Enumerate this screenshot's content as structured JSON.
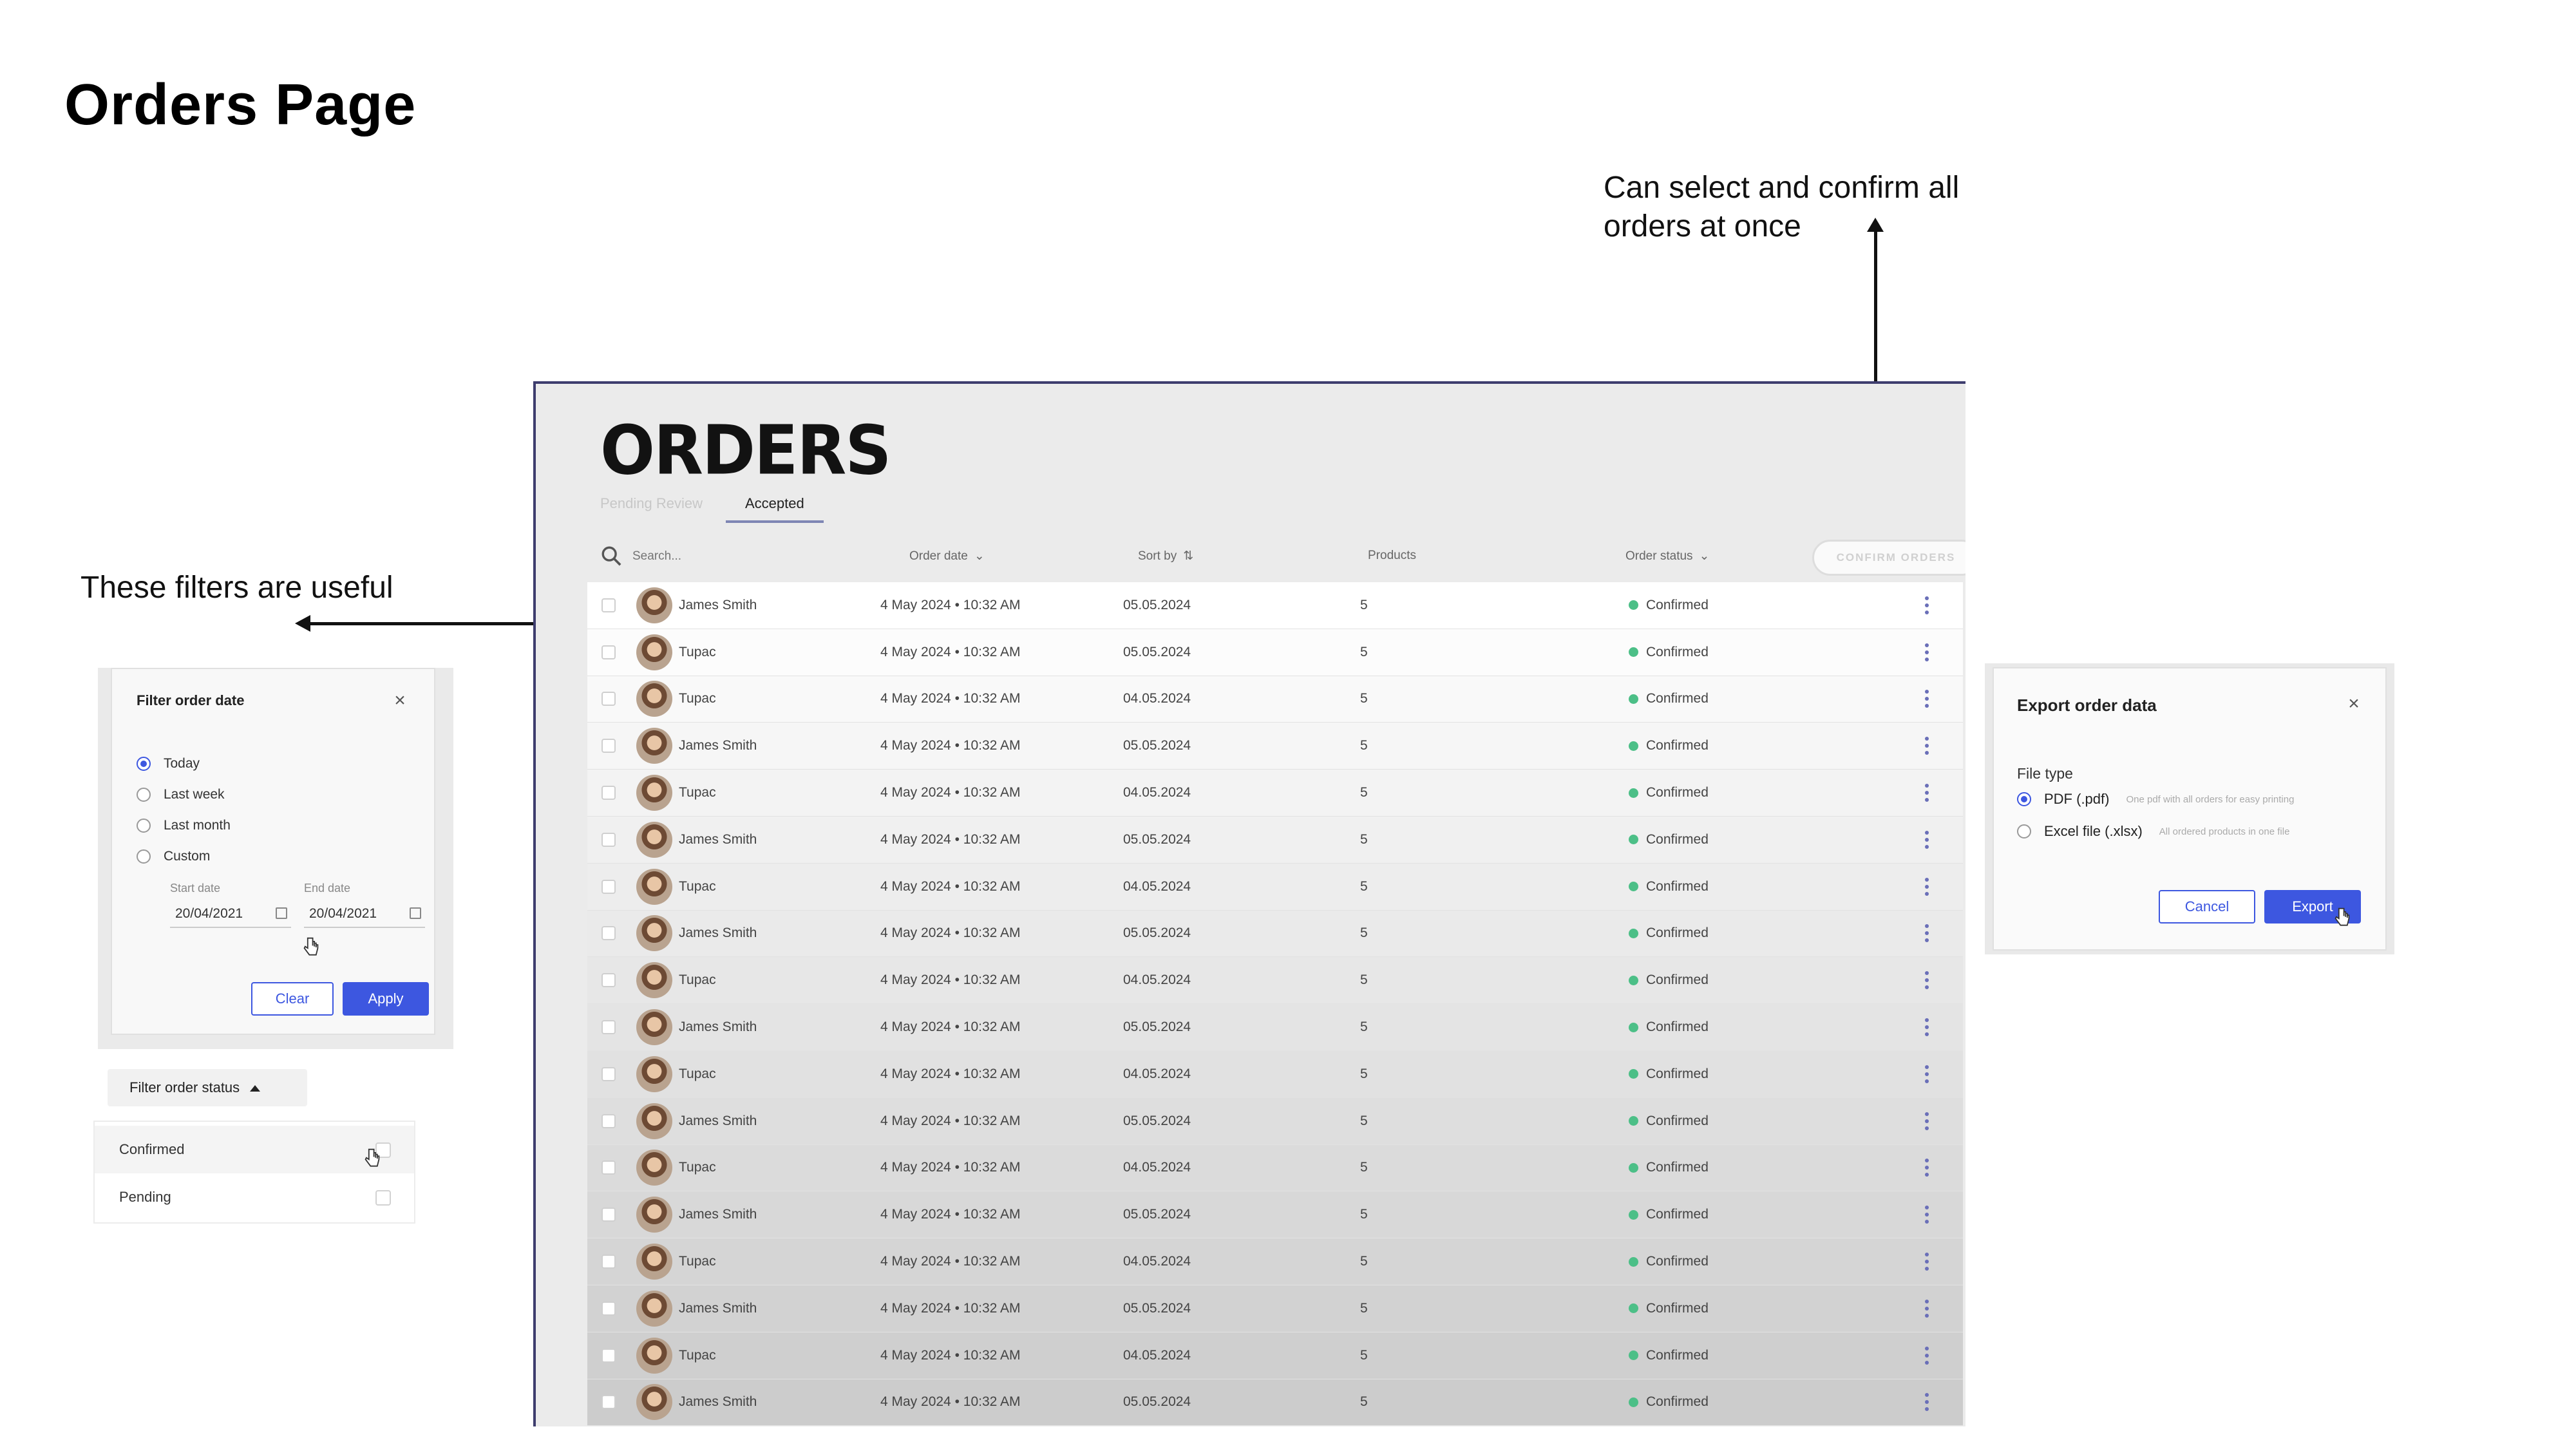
{
  "slide": {
    "title": "Orders Page",
    "note_confirm": "Can select and confirm all orders at once",
    "note_filters": "These filters are useful"
  },
  "orders": {
    "heading": "ORDERS",
    "tabs": [
      {
        "label": "Pending Review",
        "active": false
      },
      {
        "label": "Accepted",
        "active": true
      }
    ],
    "search_placeholder": "Search...",
    "columns": {
      "order_date": "Order date",
      "sort_by": "Sort by",
      "products": "Products",
      "order_status": "Order status"
    },
    "confirm_button": "CONFIRM ORDERS",
    "rows": [
      {
        "name": "James Smith",
        "order_date": "4 May 2024 • 10:32 AM",
        "delivery": "05.05.2024",
        "products": "5",
        "status": "Confirmed"
      },
      {
        "name": "Tupac",
        "order_date": "4 May 2024 • 10:32 AM",
        "delivery": "05.05.2024",
        "products": "5",
        "status": "Confirmed"
      },
      {
        "name": "Tupac",
        "order_date": "4 May 2024 • 10:32 AM",
        "delivery": "04.05.2024",
        "products": "5",
        "status": "Confirmed"
      },
      {
        "name": "James Smith",
        "order_date": "4 May 2024 • 10:32 AM",
        "delivery": "05.05.2024",
        "products": "5",
        "status": "Confirmed"
      },
      {
        "name": "Tupac",
        "order_date": "4 May 2024 • 10:32 AM",
        "delivery": "04.05.2024",
        "products": "5",
        "status": "Confirmed"
      },
      {
        "name": "James Smith",
        "order_date": "4 May 2024 • 10:32 AM",
        "delivery": "05.05.2024",
        "products": "5",
        "status": "Confirmed"
      },
      {
        "name": "Tupac",
        "order_date": "4 May 2024 • 10:32 AM",
        "delivery": "04.05.2024",
        "products": "5",
        "status": "Confirmed"
      },
      {
        "name": "James Smith",
        "order_date": "4 May 2024 • 10:32 AM",
        "delivery": "05.05.2024",
        "products": "5",
        "status": "Confirmed"
      },
      {
        "name": "Tupac",
        "order_date": "4 May 2024 • 10:32 AM",
        "delivery": "04.05.2024",
        "products": "5",
        "status": "Confirmed"
      },
      {
        "name": "James Smith",
        "order_date": "4 May 2024 • 10:32 AM",
        "delivery": "05.05.2024",
        "products": "5",
        "status": "Confirmed"
      },
      {
        "name": "Tupac",
        "order_date": "4 May 2024 • 10:32 AM",
        "delivery": "04.05.2024",
        "products": "5",
        "status": "Confirmed"
      },
      {
        "name": "James Smith",
        "order_date": "4 May 2024 • 10:32 AM",
        "delivery": "05.05.2024",
        "products": "5",
        "status": "Confirmed"
      },
      {
        "name": "Tupac",
        "order_date": "4 May 2024 • 10:32 AM",
        "delivery": "04.05.2024",
        "products": "5",
        "status": "Confirmed"
      },
      {
        "name": "James Smith",
        "order_date": "4 May 2024 • 10:32 AM",
        "delivery": "05.05.2024",
        "products": "5",
        "status": "Confirmed"
      },
      {
        "name": "Tupac",
        "order_date": "4 May 2024 • 10:32 AM",
        "delivery": "04.05.2024",
        "products": "5",
        "status": "Confirmed"
      },
      {
        "name": "James Smith",
        "order_date": "4 May 2024 • 10:32 AM",
        "delivery": "05.05.2024",
        "products": "5",
        "status": "Confirmed"
      },
      {
        "name": "Tupac",
        "order_date": "4 May 2024 • 10:32 AM",
        "delivery": "04.05.2024",
        "products": "5",
        "status": "Confirmed"
      },
      {
        "name": "James Smith",
        "order_date": "4 May 2024 • 10:32 AM",
        "delivery": "05.05.2024",
        "products": "5",
        "status": "Confirmed"
      }
    ],
    "status_color": "#4cbf87"
  },
  "filter_date": {
    "title": "Filter order date",
    "options": [
      {
        "label": "Today",
        "selected": true
      },
      {
        "label": "Last week",
        "selected": false
      },
      {
        "label": "Last month",
        "selected": false
      },
      {
        "label": "Custom",
        "selected": false
      }
    ],
    "start_label": "Start date",
    "end_label": "End date",
    "start_value": "20/04/2021",
    "end_value": "20/04/2021",
    "clear": "Clear",
    "apply": "Apply"
  },
  "filter_status": {
    "button": "Filter order status",
    "options": [
      "Confirmed",
      "Pending"
    ]
  },
  "export": {
    "title": "Export order data",
    "file_type_label": "File type",
    "options": [
      {
        "label": "PDF (.pdf)",
        "hint": "One pdf with all orders for easy printing",
        "selected": true
      },
      {
        "label": "Excel file (.xlsx)",
        "hint": "All ordered products in one file",
        "selected": false
      }
    ],
    "cancel": "Cancel",
    "export": "Export"
  },
  "colors": {
    "accent": "#3d57e0",
    "status_confirmed": "#4cbf87"
  }
}
